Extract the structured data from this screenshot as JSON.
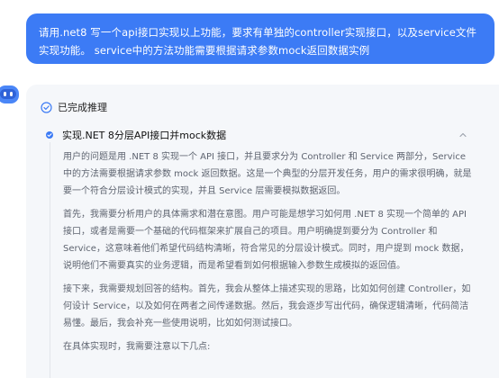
{
  "user_message": {
    "text": "请用.net8 写一个api接口实现以上功能，要求有单独的controller实现接口，以及service文件实现功能。 service中的方法功能需要根据请求参数mock返回数据实例"
  },
  "assistant": {
    "avatar_icon": "robot-icon",
    "status": {
      "icon": "check-circle-icon",
      "label": "已完成推理"
    },
    "step": {
      "icon": "dot-icon",
      "title": "实现.NET 8分层API接口并mock数据",
      "collapse_icon": "chevron-up-icon"
    },
    "paragraphs": [
      "用户的问题是用 .NET 8 实现一个 API 接口，并且要求分为 Controller 和 Service 两部分，Service 中的方法需要根据请求参数 mock 返回数据。这是一个典型的分层开发任务，用户的需求很明确，就是要一个符合分层设计模式的实现，并且 Service 层需要模拟数据返回。",
      "首先，我需要分析用户的具体需求和潜在意图。用户可能是想学习如何用 .NET 8 实现一个简单的 API 接口，或者是需要一个基础的代码框架来扩展自己的项目。用户明确提到要分为 Controller 和 Service，这意味着他们希望代码结构清晰，符合常见的分层设计模式。同时，用户提到 mock 数据，说明他们不需要真实的业务逻辑，而是希望看到如何根据输入参数生成模拟的返回值。",
      "接下来，我需要规划回答的结构。首先，我会从整体上描述实现的思路，比如如何创建 Controller，如何设计 Service，以及如何在两者之间传递数据。然后，我会逐步写出代码，确保逻辑清晰，代码简洁易懂。最后，我会补充一些使用说明，比如如何测试接口。",
      "在具体实现时，我需要注意以下几点:"
    ]
  },
  "colors": {
    "user_bubble": "#3c7bf5",
    "card_background": "#f5f7fa",
    "accent": "#3c7bf5",
    "body_text": "#5e6470"
  }
}
